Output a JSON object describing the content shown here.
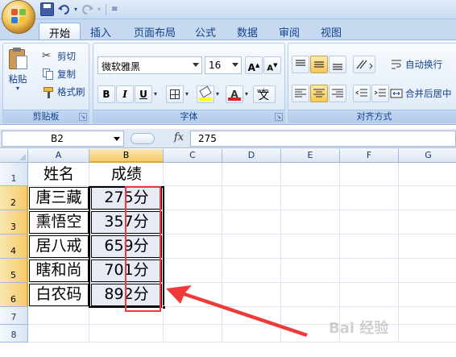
{
  "qat": {
    "icons": [
      "save-icon",
      "undo-icon",
      "redo-icon",
      "customize-icon"
    ]
  },
  "tabs": [
    "开始",
    "插入",
    "页面布局",
    "公式",
    "数据",
    "审阅",
    "视图"
  ],
  "active_tab": "开始",
  "clipboard": {
    "paste_label": "粘贴",
    "cut_label": "剪切",
    "copy_label": "复制",
    "format_painter_label": "格式刷",
    "group_label": "剪贴板"
  },
  "font": {
    "name": "微软雅黑",
    "size": "16",
    "grow_label": "A",
    "shrink_label": "A",
    "bold_label": "B",
    "italic_label": "I",
    "underline_label": "U",
    "font_color_label": "A",
    "phonetic_label": "文",
    "phonetic_top": "wén",
    "group_label": "字体"
  },
  "alignment": {
    "wrap_text_label": "自动换行",
    "merge_center_label": "合并后居中",
    "group_label": "对齐方式"
  },
  "formula_bar": {
    "name_box": "B2",
    "fx_label": "fx",
    "value": "275"
  },
  "columns": [
    "A",
    "B",
    "C",
    "D",
    "E",
    "F",
    "G"
  ],
  "rows": [
    "1",
    "2",
    "3",
    "4",
    "5",
    "6",
    "7",
    "8"
  ],
  "selected_column": "B",
  "selected_rows": [
    "2",
    "3",
    "4",
    "5",
    "6"
  ],
  "table": {
    "headers": [
      "姓名",
      "成绩"
    ],
    "names": [
      "唐三藏",
      "熏悟空",
      "居八戒",
      "瞎和尚",
      "白农码"
    ],
    "scores": [
      "275分",
      "357分",
      "659分",
      "701分",
      "892分"
    ]
  },
  "watermark": "Bai 经验",
  "colors": {
    "ribbon_bg": "#dbe8f7",
    "tab_text": "#15428b",
    "selected_header": "#f6cb6b",
    "highlight_red": "#f03a3a"
  }
}
